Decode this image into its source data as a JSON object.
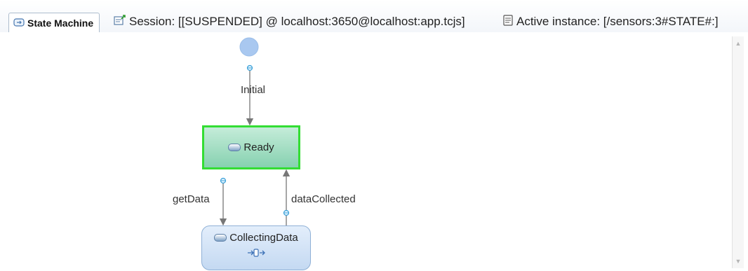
{
  "editor_tab": {
    "label": "State Machine",
    "icon": "state-machine-icon"
  },
  "header": {
    "session": {
      "icon": "session-icon",
      "text": "Session: [[SUSPENDED] @ localhost:3650@localhost:app.tcjs]"
    },
    "active_instance": {
      "icon": "instance-icon",
      "text": "Active instance: [/sensors:3#STATE#:]"
    }
  },
  "diagram": {
    "initial_node": {
      "icon": "initial-pseudostate-icon"
    },
    "states": {
      "ready": {
        "label": "Ready",
        "active": true,
        "highlight_color": "#33dd33"
      },
      "collecting": {
        "label": "CollectingData",
        "substate_icon": "submachine-icon"
      }
    },
    "transitions": {
      "initial": {
        "label": "Initial"
      },
      "get_data": {
        "label": "getData"
      },
      "data_collected": {
        "label": "dataCollected"
      }
    }
  },
  "colors": {
    "active_border": "#33dd33",
    "ready_fill": "#a8e0c6",
    "state_fill": "#d4e4f7",
    "initial_fill": "#a9c8f0",
    "edge": "#777777"
  }
}
